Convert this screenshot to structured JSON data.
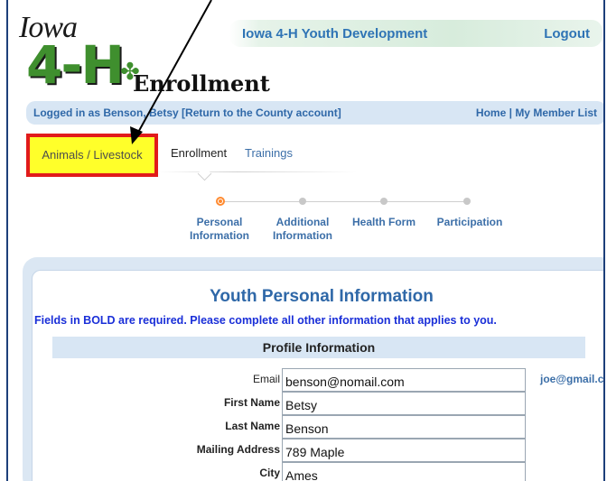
{
  "logo": {
    "iowa": "Iowa",
    "fourh": "4-H",
    "clover": "✤",
    "enrollment": "Enrollment"
  },
  "header": {
    "site_title": "Iowa 4-H Youth Development",
    "logout": "Logout"
  },
  "login_bar": {
    "logged_in_prefix": "Logged in as Benson, Betsy ",
    "return_link": "[Return to the County account]",
    "home": "Home",
    "separator": "|",
    "member_list": "My Member List"
  },
  "tabs": [
    {
      "label": "Animals / Livestock"
    },
    {
      "label": "Enrollment"
    },
    {
      "label": "Trainings"
    }
  ],
  "steps": [
    {
      "line1": "Personal",
      "line2": "Information"
    },
    {
      "line1": "Additional",
      "line2": "Information"
    },
    {
      "line1": "Health Form",
      "line2": ""
    },
    {
      "line1": "Participation",
      "line2": ""
    }
  ],
  "main": {
    "title": "Youth Personal Information",
    "required_note": "Fields in BOLD are required. Please complete all other information that applies to you.",
    "profile_header": "Profile Information"
  },
  "form": {
    "email_label": "Email",
    "email_value": "benson@nomail.com",
    "email_hint": "joe@gmail.com",
    "first_name_label": "First Name",
    "first_name_value": "Betsy",
    "last_name_label": "Last Name",
    "last_name_value": "Benson",
    "mailing_label": "Mailing Address",
    "mailing_value": "789 Maple",
    "city_label": "City",
    "city_value": "Ames"
  },
  "colors": {
    "accent_blue": "#2f74b5",
    "highlight_yellow": "#ffff2a",
    "highlight_border_red": "#e11b1b",
    "active_step_orange": "#ff8a30",
    "bar_blue": "#d8e6f4"
  },
  "annotation": {
    "arrow": "arrow-icon"
  }
}
